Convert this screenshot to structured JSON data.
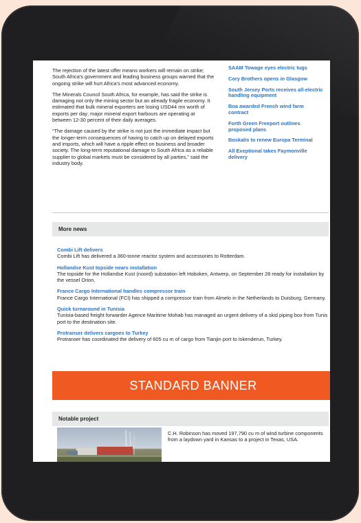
{
  "article": {
    "paragraphs": [
      "The rejection of the latest offer means workers will remain on strike; South Africa's government and leading business groups warned that the ongoing strike will hurt Africa's most advanced economy.",
      "The Minerals Council South Africa, for example, has said the strike is damaging not only the mining sector but an already fragile economy. It estimated that bulk mineral exporters are losing USD44 mn worth of exports per day; major mineral export harbours are operating at between 12-30 percent of their daily averages.",
      "“The damage caused by the strike is not just the immediate impact but the longer-term consequences of having to catch up on delayed exports and imports, which will have a ripple effect on business and broader society. The long-term reputational damage to South Africa as a reliable supplier to global markets must be considered by all parties,” said the industry body."
    ]
  },
  "related": [
    "SAAM Towage eyes electric tugs",
    "Cory Brothers opens in Glasgow",
    "South Jersey Ports receives all-electric handling equipment",
    "Boa awarded French wind farm contract",
    "Forth Green Freeport outlines proposed plans",
    "Boskalis to renew Europa Terminal",
    "All Exeptional takes Faymonville delivery"
  ],
  "more_news": {
    "heading": "More news",
    "items": [
      {
        "title": "Combi Lift delivers",
        "body": "Combi Lift has delivered a 360-tonne reactor system and accessories to Rotterdam."
      },
      {
        "title": "Hollandse Kust topside nears installation",
        "body": "The topside for the Hollandse Kust (noord) substation left Hoboken, Antwerp, on September 28 ready for installation by the vessel Orion."
      },
      {
        "title": "France Cargo International handles compressor train",
        "body": "France Cargo International (FCI) has shipped a compressor train from Almelo in the Netherlands to Duisburg, Germany."
      },
      {
        "title": "Quick turnaround in Tunisia",
        "body": "Tunisia-based freight forwarder Agence Maritime Mohab has managed an urgent delivery of a skid piping box from Tunis port to the destination site."
      },
      {
        "title": "Protranser delivers cargoes to Turkey",
        "body": "Protranser has coordinated the delivery of 605 cu m of cargo from Tianjin port to Iskenderun, Turkey."
      }
    ]
  },
  "banner": {
    "label": "STANDARD BANNER",
    "color": "#f05a22"
  },
  "notable": {
    "heading": "Notable project",
    "text": "C.H. Robinson has moved 197,790 cu m of wind turbine components from a laydown yard in Kansas to a project in Texas, USA."
  },
  "colors": {
    "link": "#2a73c7",
    "background": "#fbe6d8",
    "device": "#1f1f21"
  }
}
